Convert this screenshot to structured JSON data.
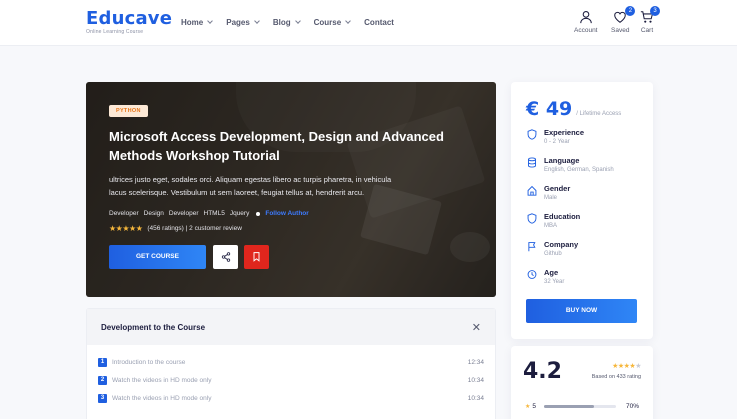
{
  "brand": {
    "name": "Educave",
    "tagline": "Online Learning Course"
  },
  "nav": [
    {
      "label": "Home",
      "has_dropdown": true
    },
    {
      "label": "Pages",
      "has_dropdown": true
    },
    {
      "label": "Blog",
      "has_dropdown": true
    },
    {
      "label": "Course",
      "has_dropdown": true
    },
    {
      "label": "Contact",
      "has_dropdown": false
    }
  ],
  "header_actions": {
    "account": {
      "label": "Account",
      "icon": "user-icon"
    },
    "saved": {
      "label": "Saved",
      "icon": "heart-icon",
      "count": "2"
    },
    "cart": {
      "label": "Cart",
      "icon": "cart-icon",
      "count": "3"
    }
  },
  "hero": {
    "tag": "PYTHON",
    "title": "Microsoft Access Development, Design and Advanced Methods Workshop Tutorial",
    "description": "ultrices justo eget, sodales orci. Aliquam egestas libero ac turpis pharetra, in vehicula lacus scelerisque. Vestibulum ut sem laoreet, feugiat tellus at, hendrerit arcu.",
    "tags": [
      "Developer",
      "Design",
      "Developer",
      "HTML5",
      "Jquery"
    ],
    "follow_label": "Follow Author",
    "stars": "★★★★★",
    "ratings_text": "(456 ratings) | 2 customer review",
    "get_course_label": "GET COURSE"
  },
  "course": {
    "title": "Development to the Course",
    "lessons": [
      {
        "num": "1",
        "title": "Introduction to the course",
        "time": "12:34"
      },
      {
        "num": "2",
        "title": "Watch the videos in HD mode only",
        "time": "10:34"
      },
      {
        "num": "3",
        "title": "Watch the videos in HD mode only",
        "time": "10:34"
      }
    ]
  },
  "sidebar": {
    "price": "€ 49",
    "price_note": "/ Lifetime Access",
    "info": [
      {
        "key": "Experience",
        "value": "0 - 2 Year",
        "icon": "shield-icon"
      },
      {
        "key": "Language",
        "value": "English, German, Spanish",
        "icon": "database-icon"
      },
      {
        "key": "Gender",
        "value": "Male",
        "icon": "home-icon"
      },
      {
        "key": "Education",
        "value": "MBA",
        "icon": "shield-icon"
      },
      {
        "key": "Company",
        "value": "Github",
        "icon": "flag-icon"
      },
      {
        "key": "Age",
        "value": "32 Year",
        "icon": "clock-icon"
      }
    ],
    "buy_label": "BUY NOW"
  },
  "rating_box": {
    "score": "4.2",
    "based_on": "Based on 433 rating",
    "stars_on": "★★★★",
    "stars_off": "★",
    "rows": [
      {
        "stars": "5",
        "percent": "70%",
        "fraction": 0.7
      }
    ]
  },
  "colors": {
    "accent": "#1f5fe0",
    "danger": "#e0261d",
    "star": "#f6b73c"
  }
}
